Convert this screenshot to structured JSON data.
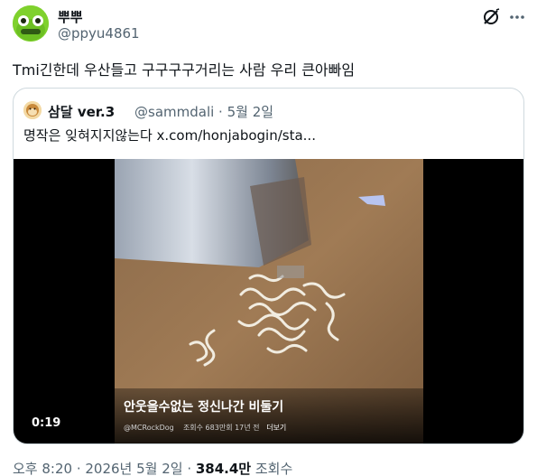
{
  "author": {
    "display_name": "뿌뿌",
    "handle": "@ppyu4861"
  },
  "tweet": {
    "text": "Tmi긴한데 우산들고 구구구구거리는 사람 우리 큰아빠임"
  },
  "quote": {
    "display_name": "삼달 ver.3",
    "meta": "@sammdali · 5월 2일",
    "text": "명작은 잊혀지지않는다  x.com/honjabogin/sta...",
    "video": {
      "title": "안웃을수없는 정신나간 비둘기",
      "channel": "@MCRockDog",
      "stats": "조회수 683만회  17년 전",
      "more": "더보기",
      "duration": "0:19"
    }
  },
  "footer": {
    "time_date": "오후 8:20 · 2026년 5월 2일 · ",
    "views_count": "384.4만",
    "views_label": " 조회수"
  },
  "icons": {
    "grok": "grok-icon",
    "more": "more-icon"
  },
  "colors": {
    "avatar_bg": "#7fd12d",
    "secondary_text": "#536471",
    "border": "#cfd9de"
  }
}
